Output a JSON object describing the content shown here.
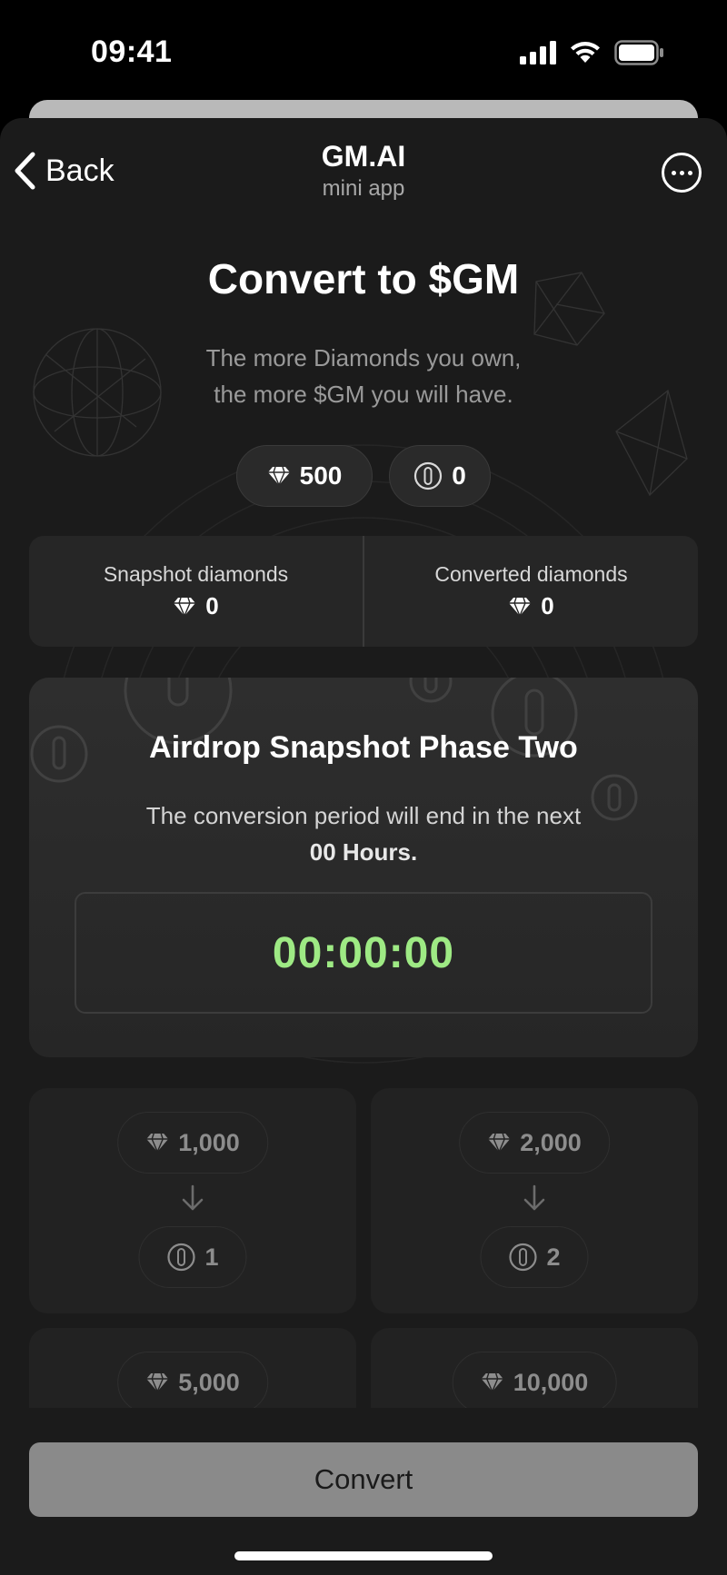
{
  "status_bar": {
    "time": "09:41"
  },
  "nav": {
    "back_label": "Back",
    "title": "GM.AI",
    "subtitle": "mini app"
  },
  "header": {
    "title": "Convert to $GM",
    "description_line1": "The more Diamonds you own,",
    "description_line2": "the more $GM you will have."
  },
  "balances": {
    "diamonds": "500",
    "gm": "0"
  },
  "stats": {
    "snapshot_label": "Snapshot diamonds",
    "snapshot_value": "0",
    "converted_label": "Converted diamonds",
    "converted_value": "0"
  },
  "phase": {
    "title": "Airdrop Snapshot Phase Two",
    "text": "The conversion period will end in the next",
    "hours": "00 Hours.",
    "timer": "00:00:00"
  },
  "options": [
    {
      "diamonds": "1,000",
      "gm": "1"
    },
    {
      "diamonds": "2,000",
      "gm": "2"
    },
    {
      "diamonds": "5,000",
      "gm": ""
    },
    {
      "diamonds": "10,000",
      "gm": ""
    }
  ],
  "convert_label": "Convert",
  "colors": {
    "timer": "#9eea84",
    "button": "#8a8a8a",
    "background": "#1b1b1b"
  }
}
